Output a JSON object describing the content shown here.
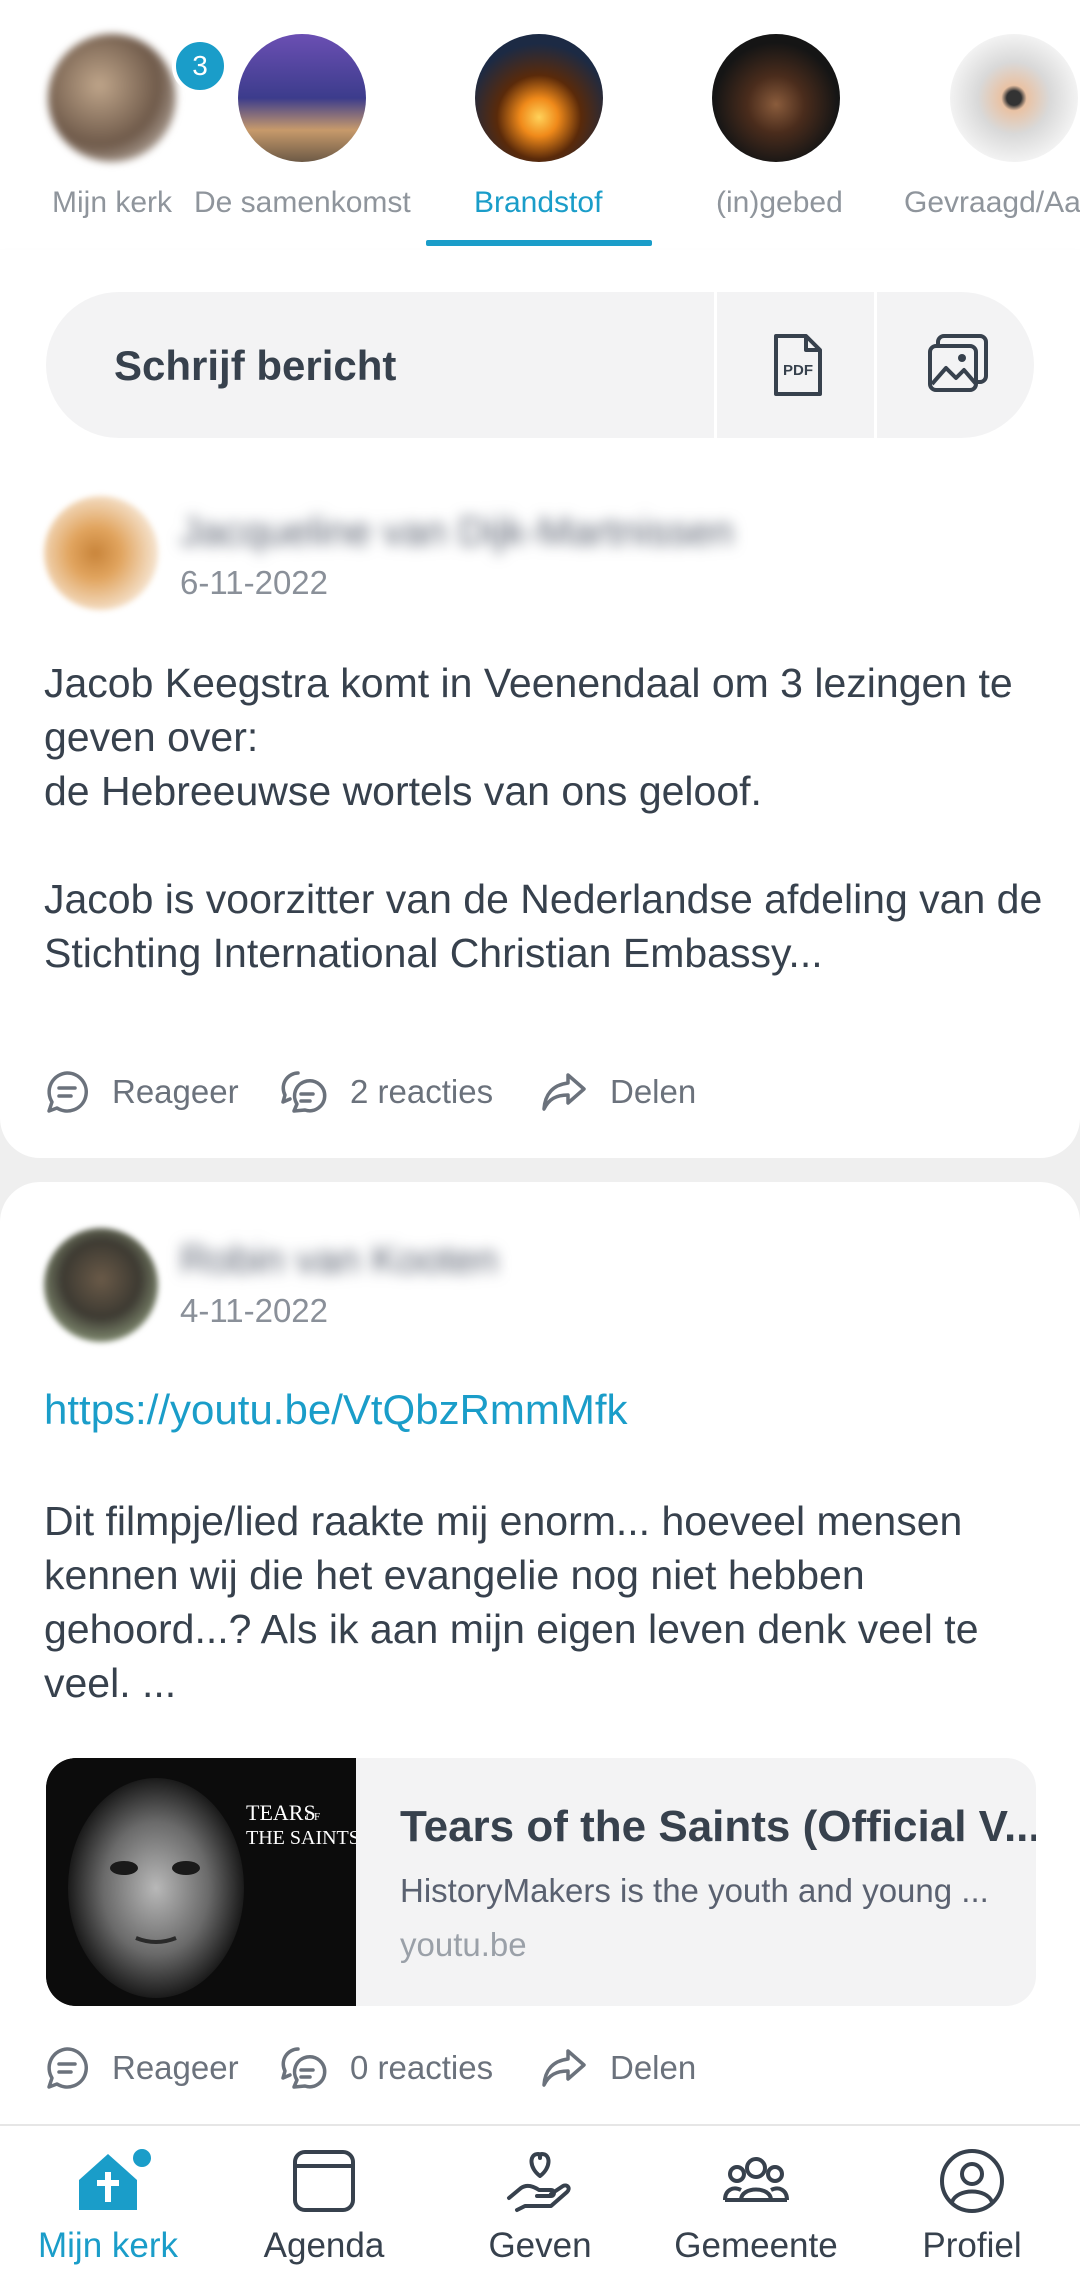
{
  "stories": [
    {
      "label": "Mijn kerk",
      "badge": "3"
    },
    {
      "label": "De samenkomst"
    },
    {
      "label": "Brandstof",
      "active": true
    },
    {
      "label": "(in)gebed"
    },
    {
      "label": "Gevraagd/Aa"
    }
  ],
  "composer": {
    "placeholder": "Schrijf bericht",
    "pdf_icon_text": "PDF"
  },
  "posts": [
    {
      "author": "Jacqueline van Dijk-Martnissen",
      "date": "6-11-2022",
      "text": "Jacob Keegstra komt in Veenendaal om 3 lezingen te geven over:\nde Hebreeuwse wortels van ons geloof.\n\nJacob is voorzitter van de Nederlandse afdeling van de Stichting International Christian Embassy...",
      "actions": {
        "reply": "Reageer",
        "reactions": "2 reacties",
        "share": "Delen"
      }
    },
    {
      "author": "Robin van Kooten",
      "date": "4-11-2022",
      "link": "https://youtu.be/VtQbzRmmMfk",
      "text": "Dit filmpje/lied raakte mij enorm... hoeveel mensen kennen wij die het evangelie nog niet hebben gehoord...? Als ik aan mijn eigen leven denk veel te veel. ...",
      "preview": {
        "title": "Tears of the Saints (Official V...",
        "description": "HistoryMakers is the youth and young ...",
        "domain": "youtu.be",
        "thumb_text_1": "TEARS",
        "thumb_text_of": "OF",
        "thumb_text_2": "THE SAINTS"
      },
      "actions": {
        "reply": "Reageer",
        "reactions": "0 reacties",
        "share": "Delen"
      }
    }
  ],
  "tabbar": [
    {
      "label": "Mijn kerk",
      "active": true
    },
    {
      "label": "Agenda"
    },
    {
      "label": "Geven"
    },
    {
      "label": "Gemeente"
    },
    {
      "label": "Profiel"
    }
  ],
  "colors": {
    "accent": "#1a9dc9",
    "text": "#37414d",
    "muted": "#8f959c"
  }
}
